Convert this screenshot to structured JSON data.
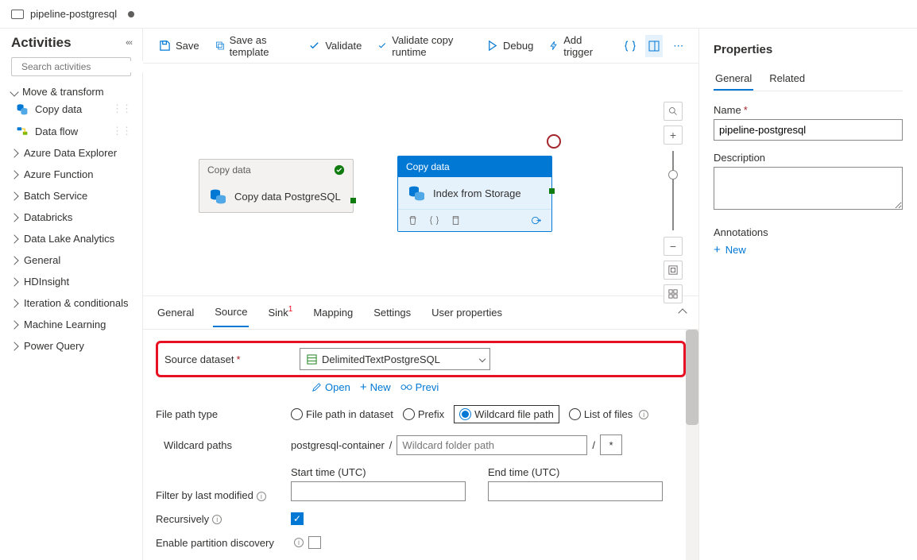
{
  "tab": {
    "title": "pipeline-postgresql"
  },
  "activities": {
    "title": "Activities",
    "search_placeholder": "Search activities",
    "group_move": "Move & transform",
    "items": [
      {
        "label": "Copy data"
      },
      {
        "label": "Data flow"
      }
    ],
    "categories": [
      "Azure Data Explorer",
      "Azure Function",
      "Batch Service",
      "Databricks",
      "Data Lake Analytics",
      "General",
      "HDInsight",
      "Iteration & conditionals",
      "Machine Learning",
      "Power Query"
    ]
  },
  "toolbar": {
    "save": "Save",
    "save_template": "Save as template",
    "validate": "Validate",
    "validate_copy": "Validate copy runtime",
    "debug": "Debug",
    "add_trigger": "Add trigger"
  },
  "canvas": {
    "node1": {
      "type": "Copy data",
      "title": "Copy data PostgreSQL"
    },
    "node2": {
      "type": "Copy data",
      "title": "Index from Storage"
    }
  },
  "detail_tabs": {
    "general": "General",
    "source": "Source",
    "sink": "Sink",
    "sink_badge": "1",
    "mapping": "Mapping",
    "settings": "Settings",
    "user_props": "User properties"
  },
  "source_form": {
    "dataset_label": "Source dataset",
    "dataset_value": "DelimitedTextPostgreSQL",
    "open": "Open",
    "new": "New",
    "preview": "Previ",
    "filepath_label": "File path type",
    "fp_dataset": "File path in dataset",
    "fp_prefix": "Prefix",
    "fp_wildcard": "Wildcard file path",
    "fp_list": "List of files",
    "wildcard_label": "Wildcard paths",
    "wildcard_container": "postgresql-container",
    "wildcard_placeholder": "Wildcard folder path",
    "wildcard_star": "*",
    "start_time": "Start time (UTC)",
    "end_time": "End time (UTC)",
    "filter_label": "Filter by last modified",
    "recursively": "Recursively",
    "partition": "Enable partition discovery"
  },
  "properties": {
    "title": "Properties",
    "tab_general": "General",
    "tab_related": "Related",
    "name_label": "Name",
    "name_value": "pipeline-postgresql",
    "desc_label": "Description",
    "annotations_label": "Annotations",
    "new": "New"
  }
}
